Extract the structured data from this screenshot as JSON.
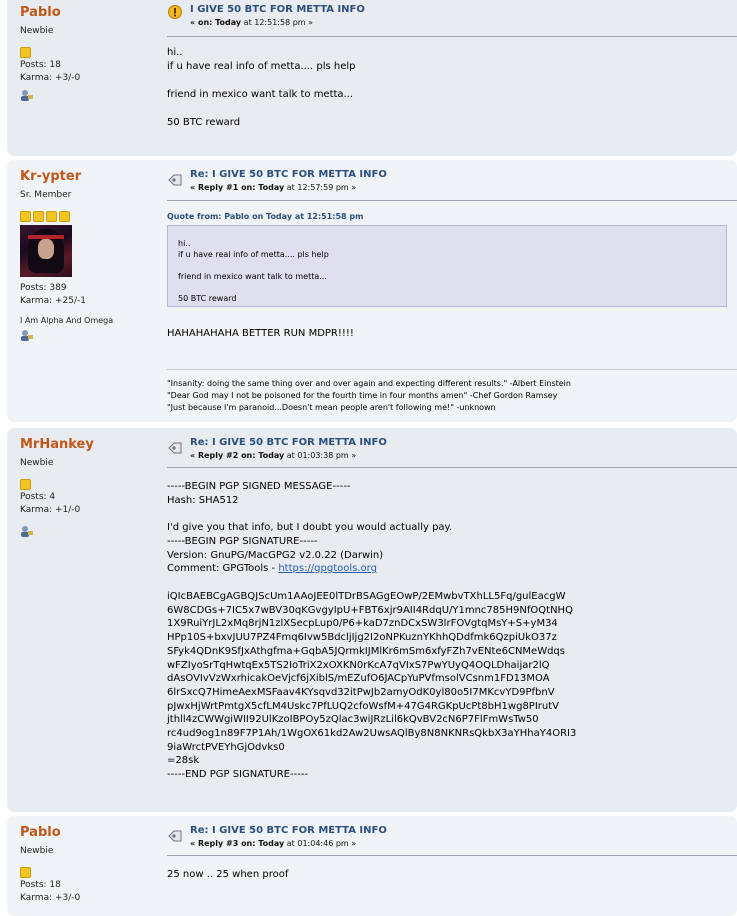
{
  "posts": [
    {
      "author": "Pablo",
      "title": "Newbie",
      "posts_count": "Posts: 18",
      "karma": "Karma: +3/-0",
      "subject": "I GIVE 50 BTC FOR METTA INFO",
      "meta_prefix": "« on: ",
      "meta_day": "Today",
      "meta_time": " at 12:51:58 pm »",
      "body": "hi..\nif u have real info of metta.... pls help\n\nfriend in mexico want talk to metta...\n\n50 BTC reward"
    },
    {
      "author": "Kr-ypter",
      "title": "Sr. Member",
      "posts_count": "Posts: 389",
      "karma": "Karma: +25/-1",
      "personal_text": "I Am Alpha And Omega",
      "subject": "Re: I GIVE 50 BTC FOR METTA INFO",
      "meta_prefix": "« Reply #1 on: ",
      "meta_day": "Today",
      "meta_time": " at 12:57:59 pm »",
      "quote_header": "Quote from: Pablo on Today at 12:51:58 pm",
      "quote_body": "hi..\nif u have real info of metta.... pls help\n\nfriend in mexico want talk to metta...\n\n50 BTC reward",
      "body": "HAHAHAHAHA BETTER RUN MDPR!!!!",
      "signature": "\"Insanity: doing the same thing over and over again and expecting different results.\" -Albert Einstein\n\"Dear God may I not be poisoned for the fourth time in four months amen\" -Chef Gordon Ramsey\n\"Just because I'm paranoid...Doesn't mean people aren't following me!\" -unknown"
    },
    {
      "author": "MrHankey",
      "title": "Newbie",
      "posts_count": "Posts: 4",
      "karma": "Karma: +1/-0",
      "subject": "Re: I GIVE 50 BTC FOR METTA INFO",
      "meta_prefix": "« Reply #2 on: ",
      "meta_day": "Today",
      "meta_time": " at 01:03:38 pm »",
      "pgp_head": "-----BEGIN PGP SIGNED MESSAGE-----\nHash: SHA512\n\nI'd give you that info, but I doubt you would actually pay.\n-----BEGIN PGP SIGNATURE-----\nVersion: GnuPG/MacGPG2 v2.0.22 (Darwin)",
      "comment_prefix": "Comment: GPGTools - ",
      "comment_link": "https://gpgtools.org",
      "pgp_tail": "iQIcBAEBCgAGBQJScUm1AAoJEE0lTDrBSAGgEOwP/2EMwbvTXhLL5Fq/gulEacgW\n6W8CDGs+7IC5x7wBV30qKGvgyIpU+FBT6xjr9AII4RdqU/Y1mnc785H9NfOQtNHQ\n1X9RuiYrJL2xMq8rjN1zlXSecpLup0/P6+kaD7znDCxSW3lrFOVgtqMsY+S+yM34\nHPp10S+bxvJUU7PZ4Fmq6Ivw5BdcljIjg2I2oNPKuznYKhhQDdfmk6QzpiUkO37z\nSFyk4QDnK9SfJxAthgfma+GqbA5JQrmkIJMlKr6mSm6xfyFZh7vENte6CNMeWdqs\nwFZIyoSrTqHwtqEx5TS2IoTriX2xOXKN0rKcA7qVIxS7PwYUyQ4OQLDhaijar2lQ\ndAsOVIvVzWxrhicakOeVjcf6jXiblS/mEZufO6JACpYuPVfmsolVCsnm1FD13MOA\n6lrSxcQ7HimeAexMSFaav4KYsqvd32itPwJb2amyOdK0yl80o5I7MKcvYD9PfbnV\npJwxHjWrtPmtgX5cfLM4Uskc7PfLUQ2cfoWsfM+47G4RGKpUcPt8bH1wg8PIrutV\njthll4zCWWgiWII92UlKzoIBPOy5zQlac3wiJRzLil6kQvBV2cN6P7FlFmWsTw50\nrc4ud9og1n89F7P1Ah/1WgOX61kd2Aw2UwsAQlBy8N8NKNRsQkbX3aYHhaY4ORI3\n9iaWrctPVEYhGjOdvks0\n=28sk\n-----END PGP SIGNATURE-----"
    },
    {
      "author": "Pablo",
      "title": "Newbie",
      "posts_count": "Posts: 18",
      "karma": "Karma: +3/-0",
      "subject": "Re: I GIVE 50 BTC FOR METTA INFO",
      "meta_prefix": "« Reply #3 on: ",
      "meta_day": "Today",
      "meta_time": " at 01:04:46 pm »",
      "body": "25 now .. 25 when proof"
    }
  ],
  "colors": {
    "author": "#c0561a",
    "subject": "#2c4f7c",
    "star": "#f3c522"
  },
  "icons": [
    "warning-icon",
    "reply-icon",
    "profile-icon",
    "star-icon"
  ]
}
